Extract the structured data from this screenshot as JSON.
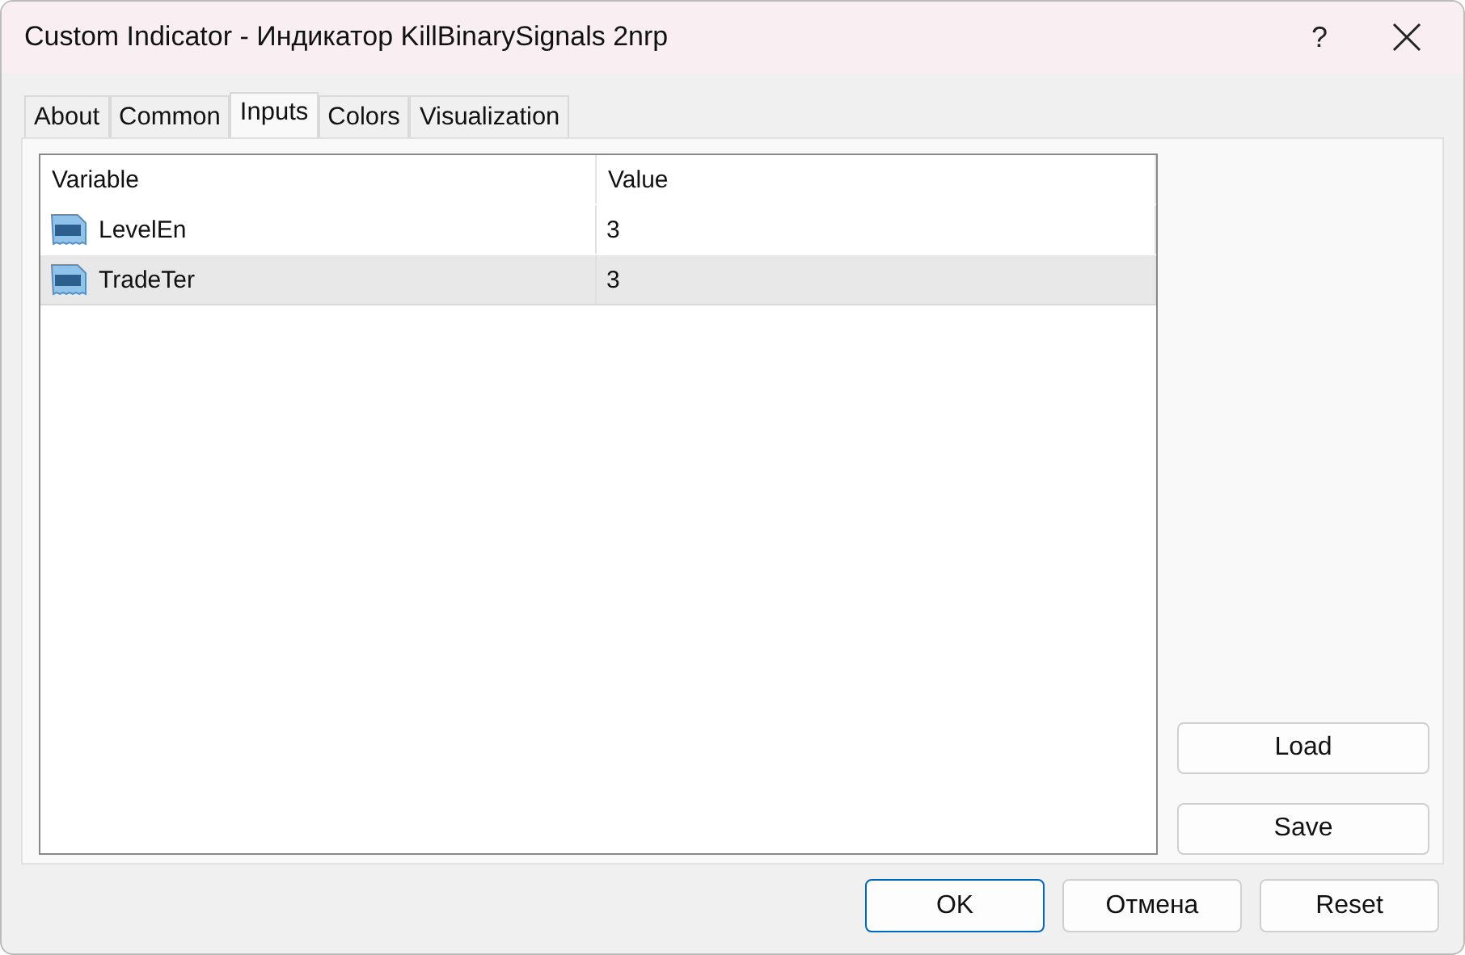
{
  "window": {
    "title": "Custom Indicator - Индикатор KillBinarySignals 2nrp",
    "help": "?"
  },
  "tabs": [
    {
      "label": "About",
      "selected": false
    },
    {
      "label": "Common",
      "selected": false
    },
    {
      "label": "Inputs",
      "selected": true
    },
    {
      "label": "Colors",
      "selected": false
    },
    {
      "label": "Visualization",
      "selected": false
    }
  ],
  "table": {
    "columns": [
      "Variable",
      "Value"
    ],
    "rows": [
      {
        "variable": "LevelEn",
        "value": "3",
        "selected": false
      },
      {
        "variable": "TradeTer",
        "value": "3",
        "selected": true
      }
    ]
  },
  "side_buttons": [
    "Load",
    "Save"
  ],
  "buttons": [
    {
      "label": "OK",
      "default": true
    },
    {
      "label": "Отмена",
      "default": false
    },
    {
      "label": "Reset",
      "default": false
    }
  ]
}
